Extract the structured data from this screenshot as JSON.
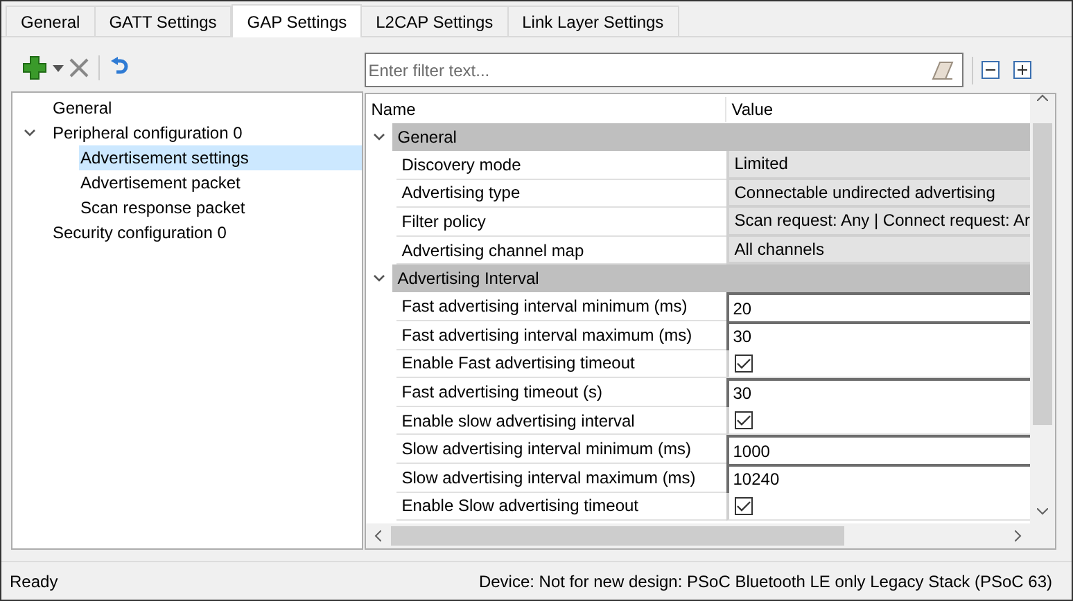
{
  "tabs": [
    {
      "label": "General",
      "selected": false
    },
    {
      "label": "GATT Settings",
      "selected": false
    },
    {
      "label": "GAP Settings",
      "selected": true
    },
    {
      "label": "L2CAP Settings",
      "selected": false
    },
    {
      "label": "Link Layer Settings",
      "selected": false
    }
  ],
  "tree": [
    {
      "label": "General",
      "selected": false
    },
    {
      "label": "Peripheral configuration 0",
      "selected": false,
      "expanded": true,
      "children": [
        {
          "label": "Advertisement settings",
          "selected": true
        },
        {
          "label": "Advertisement packet",
          "selected": false
        },
        {
          "label": "Scan response packet",
          "selected": false
        }
      ]
    },
    {
      "label": "Security configuration 0",
      "selected": false
    }
  ],
  "filter": {
    "placeholder": "Enter filter text..."
  },
  "grid": {
    "columns": [
      "Name",
      "Value"
    ],
    "groups": [
      {
        "label": "General",
        "expanded": true,
        "rows": [
          {
            "name": "Discovery mode",
            "kind": "dropdown",
            "value": "Limited"
          },
          {
            "name": "Advertising type",
            "kind": "dropdown",
            "value": "Connectable undirected advertising"
          },
          {
            "name": "Filter policy",
            "kind": "dropdown",
            "value": "Scan request: Any | Connect request: Ar"
          },
          {
            "name": "Advertising channel map",
            "kind": "dropdown",
            "value": "All channels"
          }
        ]
      },
      {
        "label": "Advertising Interval",
        "expanded": true,
        "rows": [
          {
            "name": "Fast advertising interval minimum (ms)",
            "kind": "text",
            "value": "20"
          },
          {
            "name": "Fast advertising interval maximum (ms)",
            "kind": "text",
            "value": "30"
          },
          {
            "name": "Enable Fast advertising timeout",
            "kind": "checkbox",
            "checked": true
          },
          {
            "name": "Fast advertising timeout (s)",
            "kind": "text",
            "value": "30"
          },
          {
            "name": "Enable slow advertising interval",
            "kind": "checkbox",
            "checked": true
          },
          {
            "name": "Slow advertising interval minimum (ms)",
            "kind": "text",
            "value": "1000"
          },
          {
            "name": "Slow advertising interval maximum (ms)",
            "kind": "text",
            "value": "10240"
          },
          {
            "name": "Enable Slow advertising timeout",
            "kind": "checkbox",
            "checked": true
          }
        ]
      }
    ]
  },
  "status_bar": {
    "left": "Ready",
    "right": "Device: Not for new design: PSoC Bluetooth LE only Legacy Stack (PSoC 63)"
  }
}
